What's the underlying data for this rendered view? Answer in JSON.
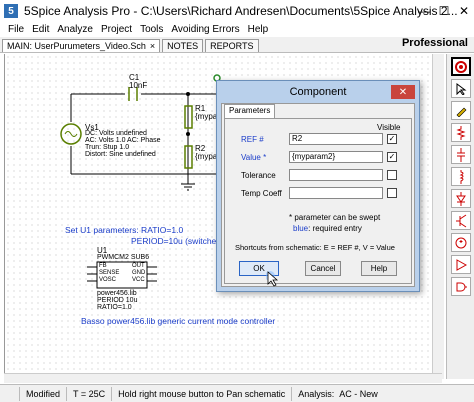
{
  "window": {
    "icon_letter": "5",
    "title": "5Spice Analysis Pro - C:\\Users\\Richard Andresen\\Documents\\5Spice Analysis 2...",
    "minimize": "—",
    "maximize": "☐",
    "close": "✕"
  },
  "menu": [
    "File",
    "Edit",
    "Analyze",
    "Project",
    "Tools",
    "Avoiding Errors",
    "Help"
  ],
  "tabs": {
    "main": "MAIN: UserPurumeters_Video.Sch",
    "main_close": "×",
    "notes": "NOTES",
    "reports": "REPORTS"
  },
  "edition": "Professional",
  "schematic": {
    "c1_name": "C1",
    "c1_value": "10nF",
    "r1_name": "R1",
    "r1_value": "{myparam",
    "r2_name": "R2",
    "r2_value": "{myparam",
    "vs_name": "Vs1",
    "vs_line1": "DC: Volts undefined",
    "vs_line2": "AC: Volts 1.0  AC: Phase",
    "vs_line3": "Trun: Stup 1.0",
    "vs_line4": "Distort: Sine  undefined",
    "param_line1": "Set U1 parameters: RATIO=1.0",
    "param_line2": "PERIOD=10u  (switches at",
    "u1_name": "U1",
    "u1_model": "PWMCM2 SUB6",
    "u1_pins_left": [
      "FB",
      "SENSE",
      "VOSC"
    ],
    "u1_pins_right": [
      "OUT",
      "GND",
      "VCC"
    ],
    "u1_lib": "power456.lib",
    "u1_period": "PERIOD  10u",
    "u1_ratio": "RATIO=1.0",
    "caption": "Basso power456.lib generic current mode controller"
  },
  "dialog": {
    "title": "Component",
    "close": "✕",
    "tab": "Parameters",
    "visible_header": "Visible",
    "rows": [
      {
        "label": "REF #",
        "value": "R2",
        "checked": "✓"
      },
      {
        "label": "Value *",
        "value": "{myparam2}",
        "checked": "✓"
      },
      {
        "label": "Tolerance",
        "value": "",
        "checked": ""
      },
      {
        "label": "Temp Coeff",
        "value": "",
        "checked": ""
      }
    ],
    "note_line1": "* parameter can be swept",
    "note_blue": "blue",
    "note_line2": ": required entry",
    "shortcuts": "Shortcuts from schematic: E = REF #,  V = Value",
    "ok": "OK",
    "cancel": "Cancel",
    "help": "Help"
  },
  "status": {
    "state": "Modified",
    "temp": "T = 25C",
    "hint": "Hold right mouse button to Pan schematic",
    "analysis_label": "Analysis:",
    "analysis_value": "AC - New"
  },
  "colors": {
    "title_bar": "#ffffff",
    "dialog_frame": "#b9d0eb",
    "wire": "#000000",
    "component": "#5a7f00",
    "annotation_blue": "#1a3cc9",
    "close_red": "#c9453d"
  }
}
